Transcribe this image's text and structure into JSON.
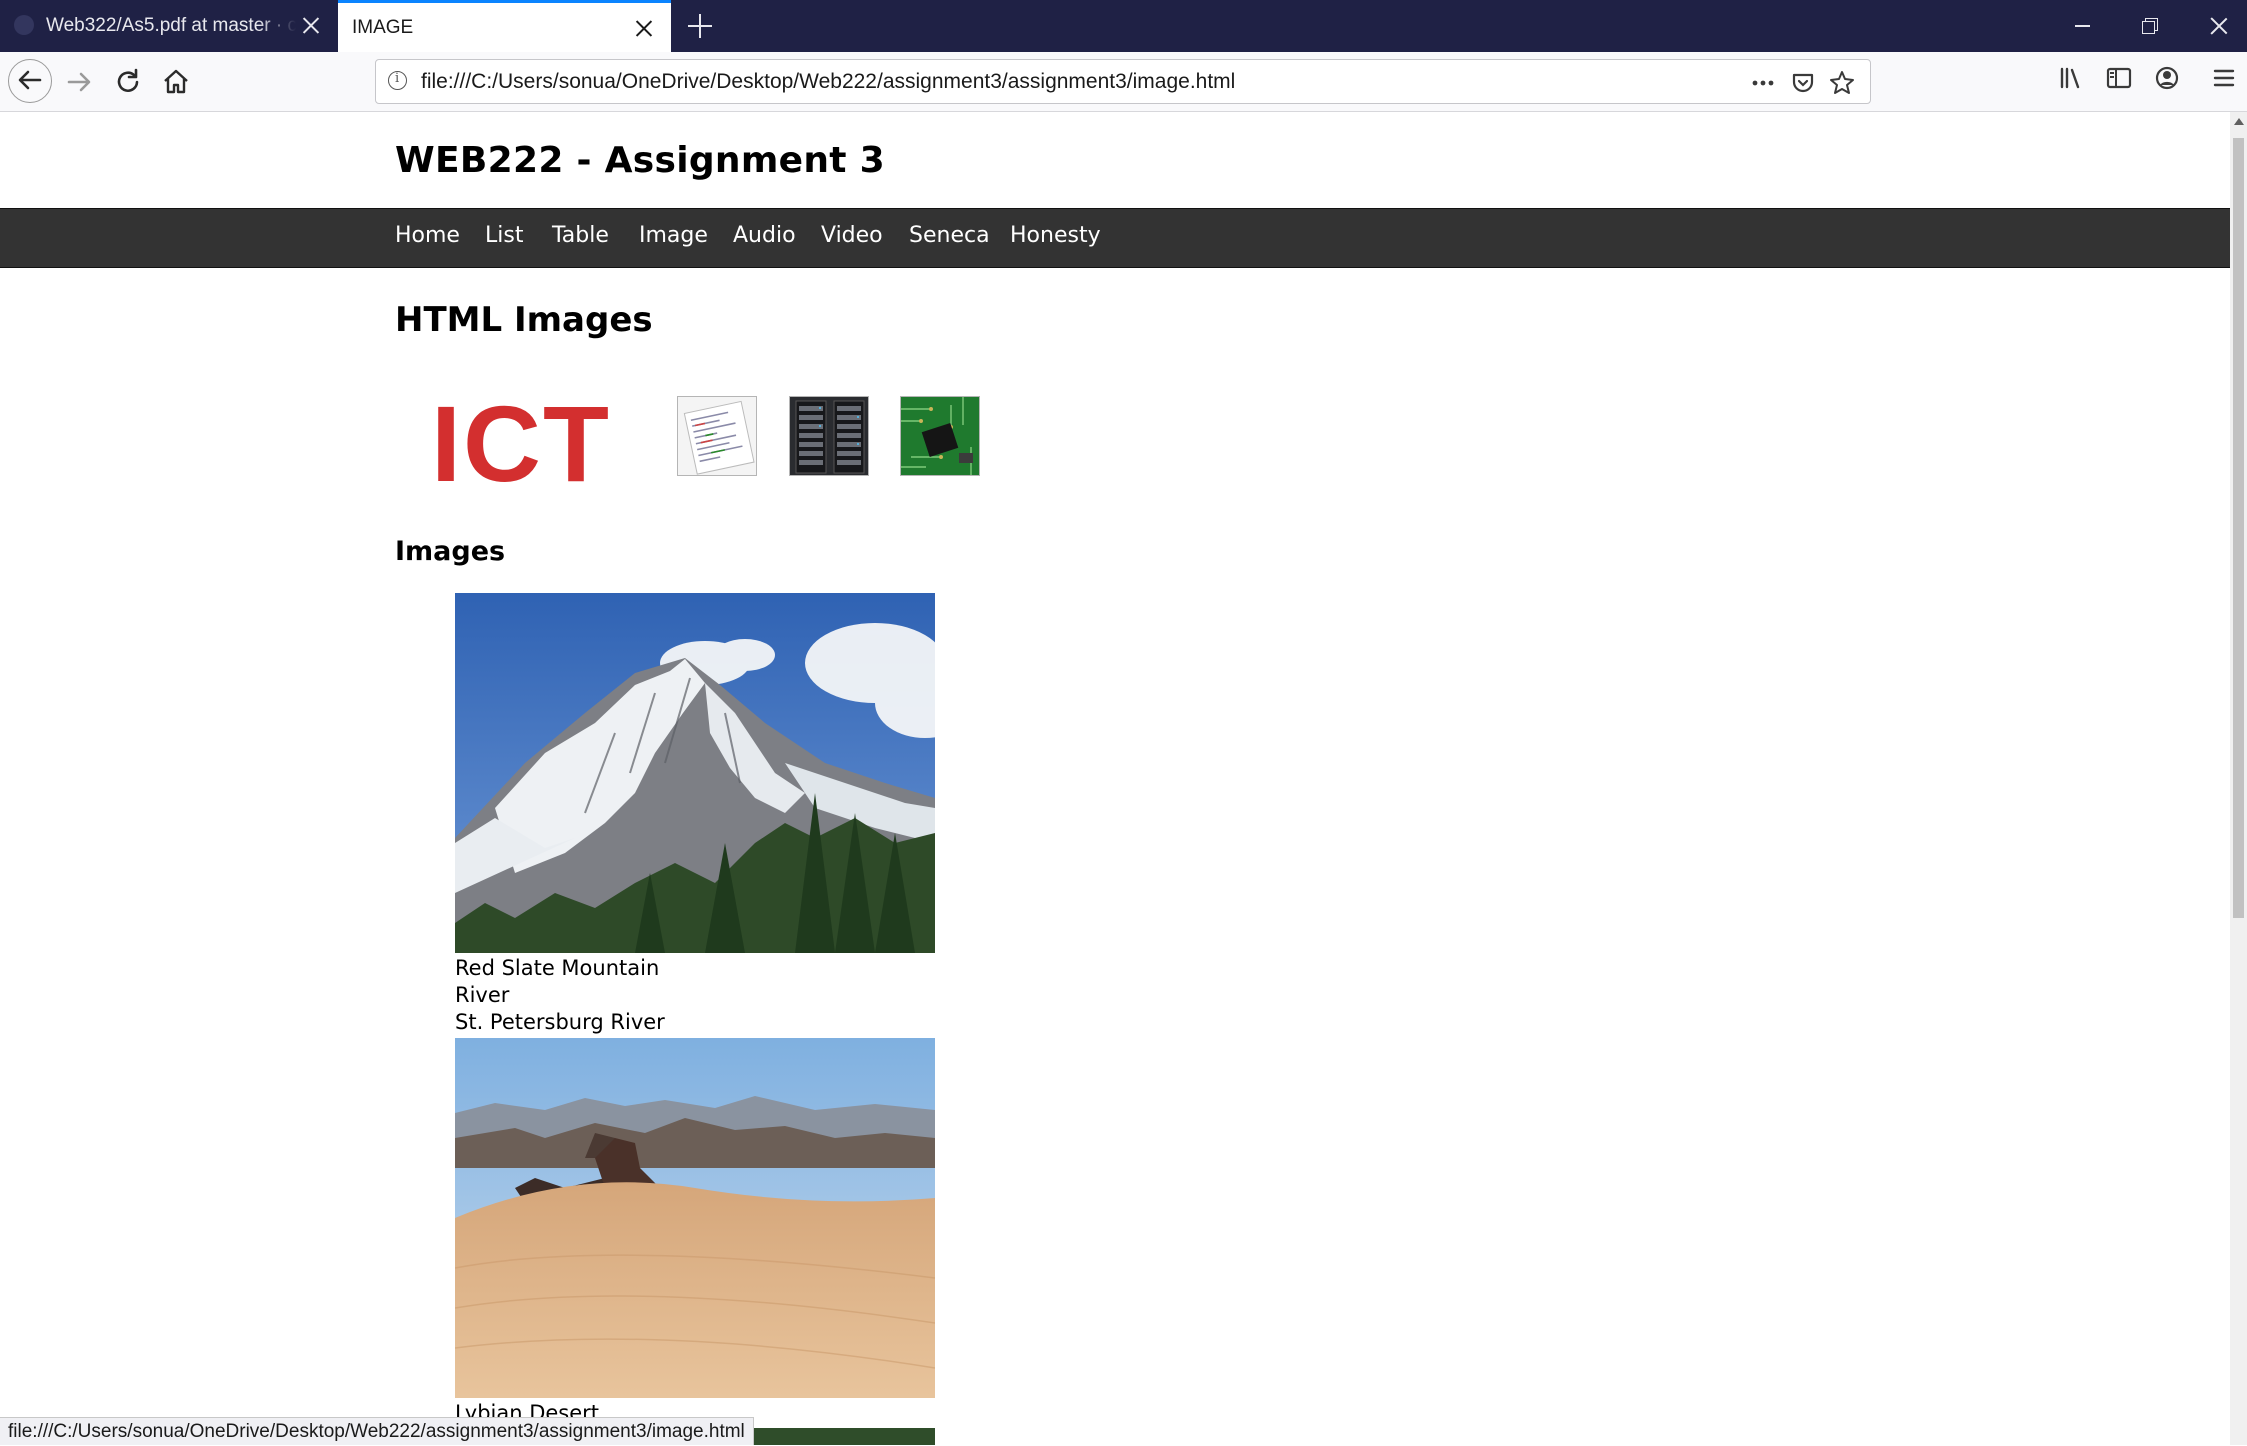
{
  "browser": {
    "tabs": [
      {
        "label": "Web322/As5.pdf at master · cnu"
      },
      {
        "label": "IMAGE"
      }
    ],
    "url": "file:///C:/Users/sonua/OneDrive/Desktop/Web222/assignment3/assignment3/image.html",
    "status_url": "file:///C:/Users/sonua/OneDrive/Desktop/Web222/assignment3/assignment3/image.html",
    "accent_color": "#0a84ff"
  },
  "page": {
    "site_title": "WEB222 - Assignment 3",
    "nav": [
      "Home",
      "List",
      "Table",
      "Image",
      "Audio",
      "Video",
      "Seneca",
      "Honesty"
    ],
    "heading": "HTML Images",
    "logo_text": "ICT",
    "logo_color": "#d32f2f",
    "images_heading": "Images",
    "captions": [
      [
        "Red Slate Mountain",
        "River",
        "St. Petersburg River"
      ],
      [
        "Lybian Desert"
      ]
    ],
    "nav_bg_color": "#333333"
  }
}
